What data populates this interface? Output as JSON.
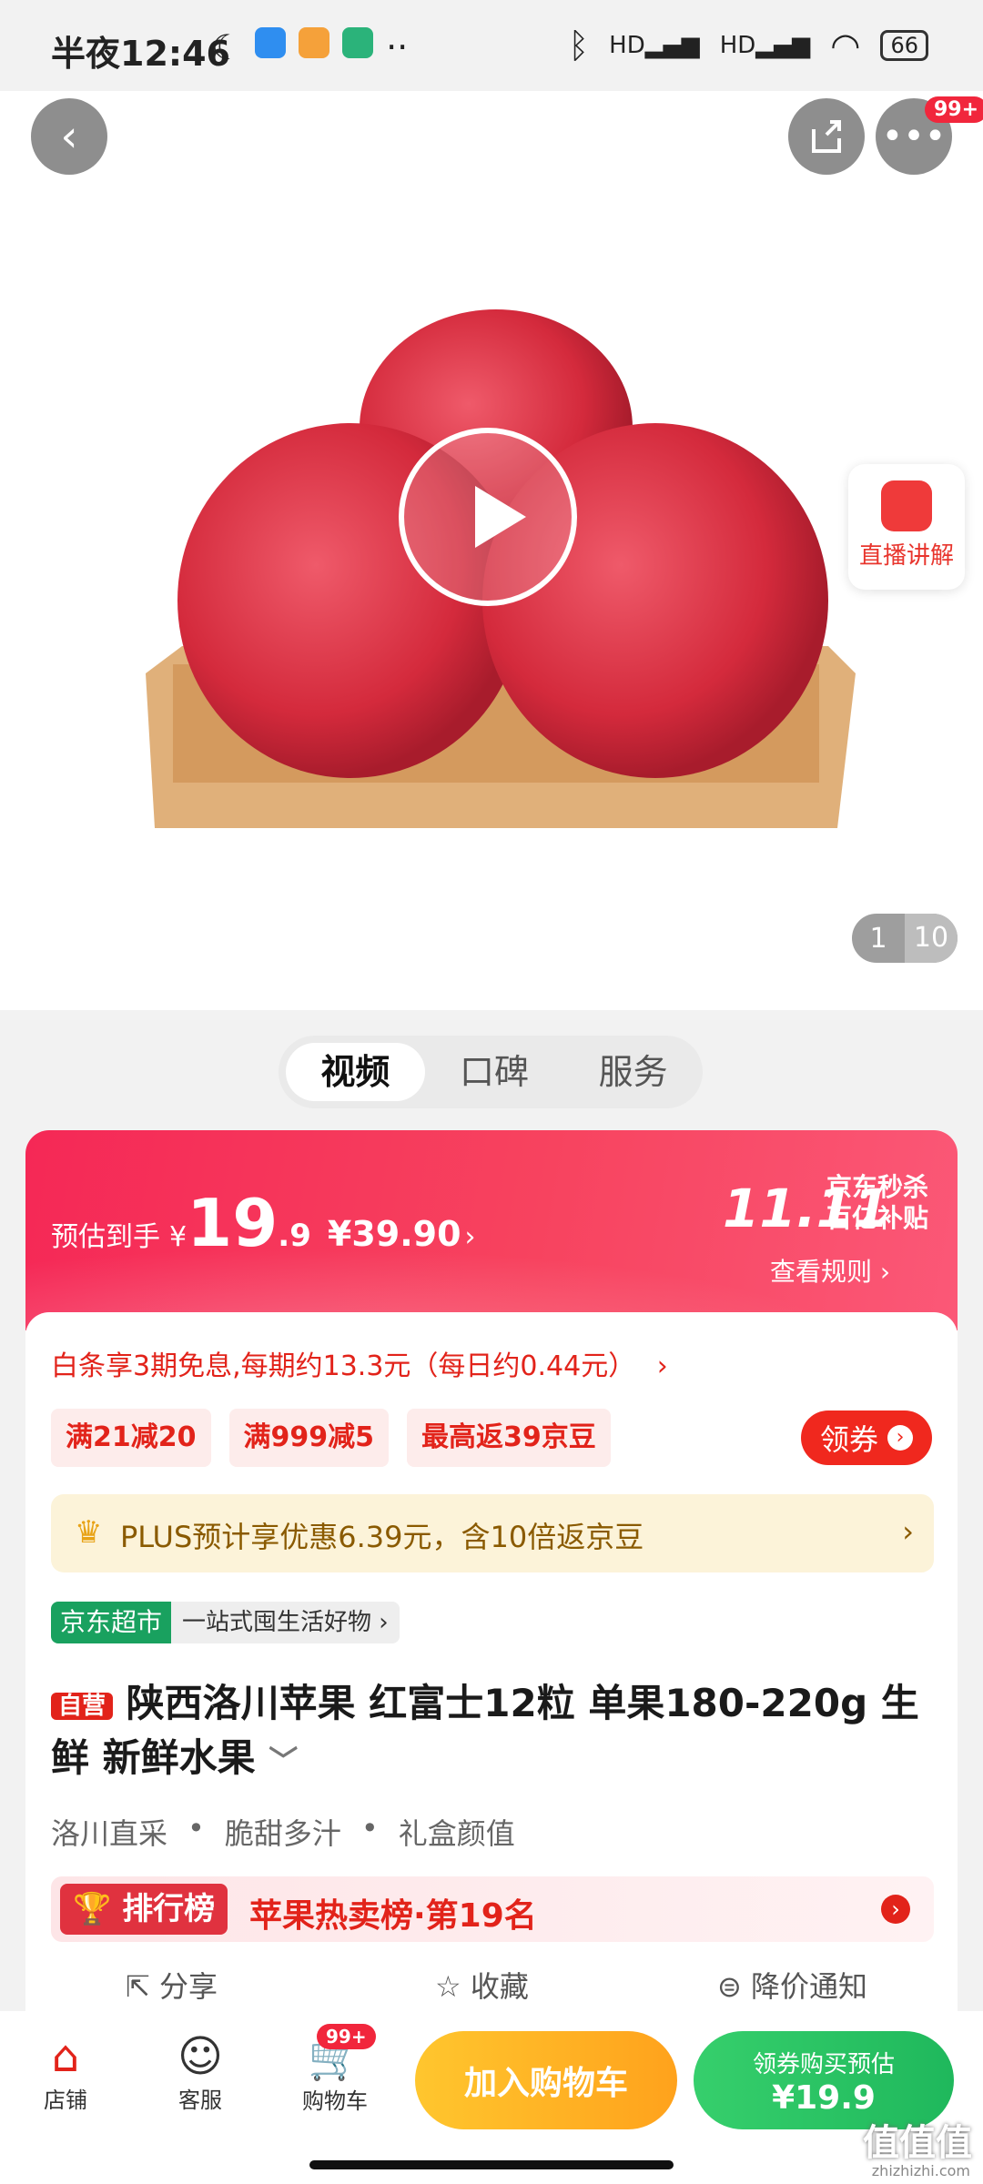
{
  "status_bar": {
    "time": "半夜12:46",
    "battery": "66"
  },
  "hero": {
    "share_badge": "99+",
    "live_label": "直播讲解",
    "pager_current": "1",
    "pager_total": "10"
  },
  "tabs": [
    {
      "label": "视频"
    },
    {
      "label": "口碑"
    },
    {
      "label": "服务"
    }
  ],
  "price": {
    "estimate_label": "预估到手",
    "currency": "¥",
    "price_int": "19",
    "price_dec": ".9",
    "original": "¥39.90",
    "promo_line1": "京东秒杀",
    "promo_line2": "百亿补贴",
    "rules_label": "查看规则 ›",
    "event": "11.11"
  },
  "baitiao": "白条享3期免息,每期约13.3元（每日约0.44元）",
  "coupons": [
    {
      "label": "满21减20"
    },
    {
      "label": "满999减5"
    },
    {
      "label": "最高返39京豆"
    }
  ],
  "coupon_button": "领券",
  "plus_text": "PLUS预计享优惠6.39元，含10倍返京豆",
  "store": {
    "tag": "京东超市",
    "desc": "一站式囤生活好物 ›"
  },
  "product": {
    "self_tag": "自营",
    "title_line1": "陕西洛川苹果 红富士12粒 单果180-220g 生",
    "title_line2": "鲜 新鲜水果",
    "features": [
      "洛川直采",
      "脆甜多汁",
      "礼盒颜值"
    ]
  },
  "rank": {
    "tag": "排行榜",
    "text": "苹果热卖榜·第19名"
  },
  "actions": {
    "share": "分享",
    "favorite": "收藏",
    "price_alert": "降价通知"
  },
  "bottom": {
    "store": "店铺",
    "service": "客服",
    "cart": "购物车",
    "cart_badge": "99+",
    "add_cart": "加入购物车",
    "buy_line1": "领券购买预估",
    "buy_line2": "¥19.9"
  },
  "watermark": {
    "text": "值值值",
    "sub": "zhizhizhi.com"
  }
}
